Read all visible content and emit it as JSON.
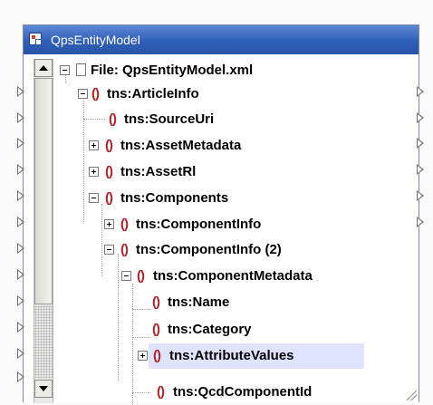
{
  "window": {
    "title": "QpsEntityModel"
  },
  "tree": {
    "file_label": "File: QpsEntityModel.xml",
    "element_icon_glyph": "()",
    "items": [
      {
        "label": "tns:ArticleInfo",
        "expander": "minus"
      },
      {
        "label": "tns:SourceUri",
        "expander": "none"
      },
      {
        "label": "tns:AssetMetadata",
        "expander": "plus"
      },
      {
        "label": "tns:AssetRl",
        "expander": "plus"
      },
      {
        "label": "tns:Components",
        "expander": "minus"
      },
      {
        "label": "tns:ComponentInfo",
        "expander": "plus"
      },
      {
        "label": "tns:ComponentInfo (2)",
        "expander": "minus"
      },
      {
        "label": "tns:ComponentMetadata",
        "expander": "minus"
      },
      {
        "label": "tns:Name",
        "expander": "none"
      },
      {
        "label": "tns:Category",
        "expander": "none"
      },
      {
        "label": "tns:AttributeValues",
        "expander": "plus",
        "selected": true
      },
      {
        "label": "tns:QcdComponentId",
        "expander": "none"
      }
    ]
  },
  "colors": {
    "titlebar": "#2f5fb8",
    "element_icon": "#b22222",
    "selection": "#e0e3ff"
  }
}
